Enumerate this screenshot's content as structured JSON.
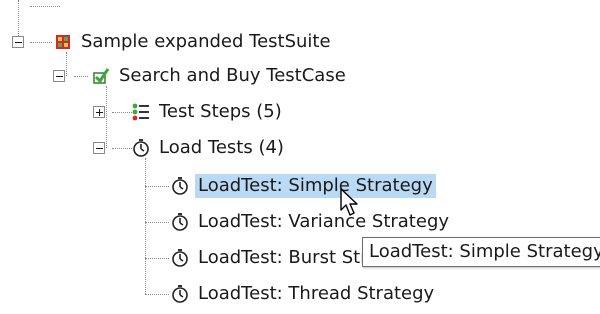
{
  "tree": {
    "suite": {
      "label": "Sample expanded TestSuite",
      "icon": "testsuite-grid-icon",
      "expanded": true
    },
    "testcase": {
      "label": "Search  and Buy TestCase",
      "icon": "testcase-check-icon",
      "expanded": true
    },
    "steps": {
      "label": "Test Steps (5)",
      "icon": "test-steps-list-icon",
      "expanded": false
    },
    "loadtests": {
      "label": "Load Tests (4)",
      "icon": "stopwatch-icon",
      "expanded": true
    },
    "items": [
      {
        "label": "LoadTest: Simple Strategy",
        "icon": "stopwatch-icon",
        "selected": true
      },
      {
        "label": "LoadTest: Variance Strategy",
        "icon": "stopwatch-icon",
        "selected": false
      },
      {
        "label": "LoadTest: Burst Strategy",
        "icon": "stopwatch-icon",
        "selected": false
      },
      {
        "label": "LoadTest: Thread Strategy",
        "icon": "stopwatch-icon",
        "selected": false
      }
    ]
  },
  "tooltip": {
    "text": "LoadTest: Simple Strategy"
  },
  "cursor": {
    "icon": "mouse-pointer-icon"
  },
  "colors": {
    "selection": "#b9d9f5",
    "tree_lines": "#8c8c8c"
  }
}
